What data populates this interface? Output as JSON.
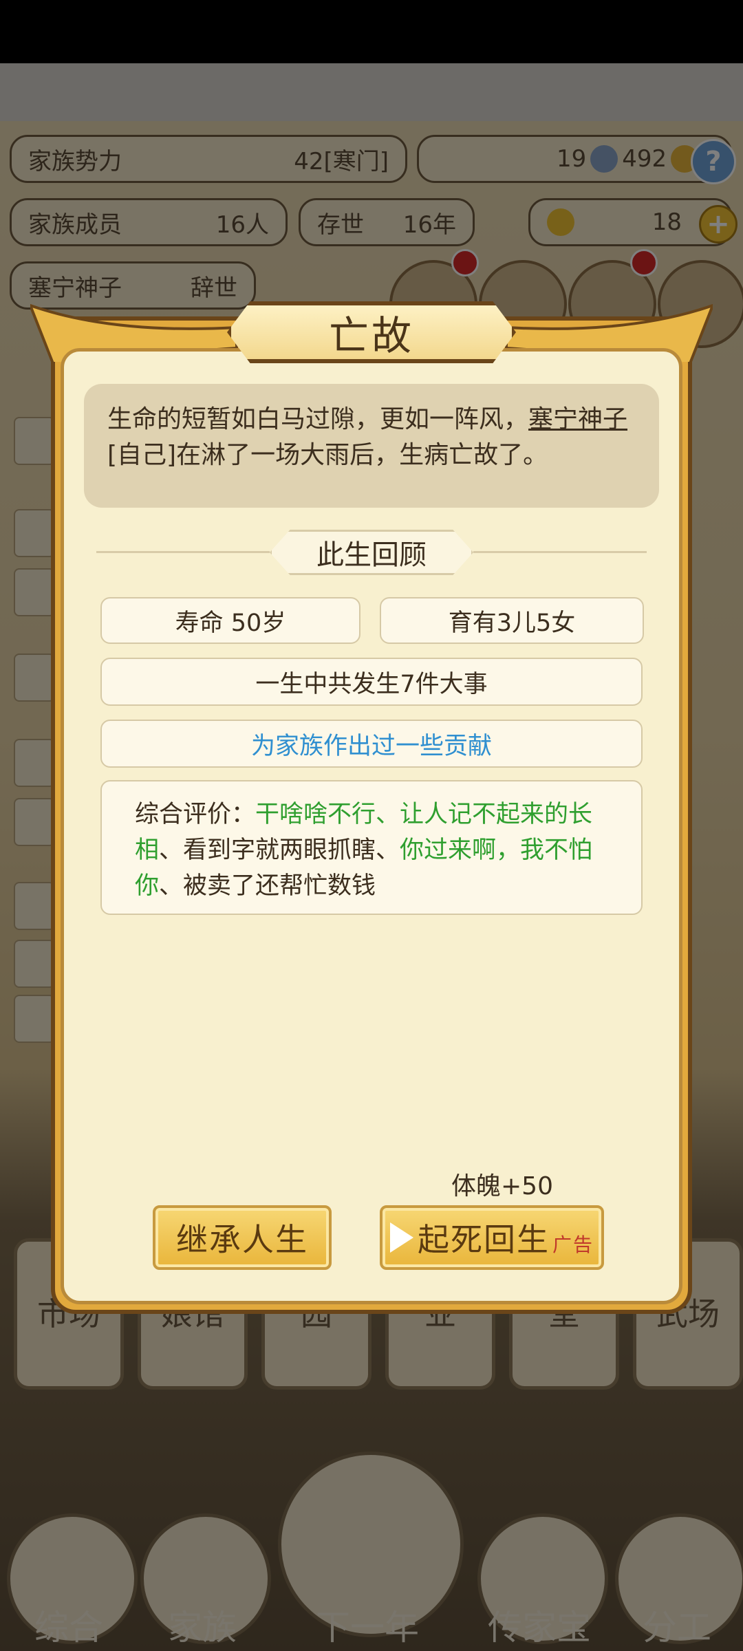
{
  "header": {
    "clan_power_label": "家族势力",
    "clan_power_value": "42[寒门]",
    "currency_a": "19",
    "currency_b": "492",
    "members_label": "家族成员",
    "members_value": "16人",
    "alive_label": "存世",
    "alive_value": "16年",
    "gold_value": "18",
    "help_icon": "?",
    "plus_icon": "+",
    "person_name": "塞宁神子",
    "person_status": "辞世"
  },
  "background_buildings": [
    "市场",
    "娘馆",
    "园",
    "业",
    "堂",
    "武场"
  ],
  "bottom_nav": [
    "综合",
    "家族",
    "下一年",
    "传家宝",
    "分工"
  ],
  "modal": {
    "title": "亡故",
    "description_pre": "生命的短暂如白马过隙，更如一阵风，",
    "description_name": "塞宁神子",
    "description_post": "[自己]在淋了一场大雨后，生病亡故了。",
    "section_title": "此生回顾",
    "lifespan": "寿命 50岁",
    "children": "育有3儿5女",
    "events": "一生中共发生7件大事",
    "contribution": "为家族作出过一些贡献",
    "evaluation": {
      "label": "综合评价：",
      "part1": "干啥啥不行、让人记不起来的长相",
      "sep1": "、看到字就两眼抓瞎、",
      "part2": "你过来啊，我不怕你",
      "sep2": "、被卖了还帮忙数钱"
    },
    "bonus": "体魄+50",
    "inherit_button": "继承人生",
    "revive_button": "起死回生",
    "ad_tag": "广告"
  },
  "colors": {
    "gold": "#e2a93d",
    "parchment": "#f8f0cf",
    "green_trait": "#2f9f2f",
    "blue_contribution": "#2f8fd0",
    "ad_red": "#c0392b"
  }
}
